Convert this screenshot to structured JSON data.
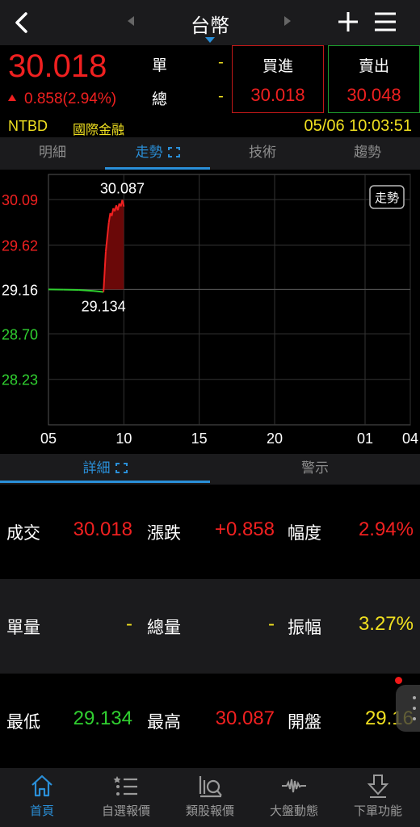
{
  "header": {
    "title": "台幣",
    "back_icon": "back-chevron-icon",
    "prev_icon": "prev-triangle-icon",
    "next_icon": "next-triangle-icon",
    "add_icon": "plus-icon",
    "menu_icon": "hamburger-menu-icon"
  },
  "quote": {
    "price": "30.018",
    "change": "0.858(2.94%)",
    "unit_label": "單",
    "total_label": "總",
    "unit_value": "-",
    "total_value": "-",
    "bid_label": "買進",
    "bid_value": "30.018",
    "ask_label": "賣出",
    "ask_value": "30.048",
    "code": "NTBD",
    "company": "國際金融",
    "datetime": "05/06 10:03:51",
    "colors": {
      "up": "#f02020",
      "down": "#30d030",
      "accent": "#2a8fd8",
      "highlight": "#f0e020"
    }
  },
  "tabs": [
    {
      "label": "明細"
    },
    {
      "label": "走勢"
    },
    {
      "label": "技術"
    },
    {
      "label": "趨勢"
    }
  ],
  "chart_data": {
    "type": "line",
    "badge": "走勢",
    "y_ticks": [
      "30.09",
      "29.62",
      "29.16",
      "28.70",
      "28.23"
    ],
    "y_tick_values": [
      30.09,
      29.62,
      29.16,
      28.7,
      28.23
    ],
    "x_ticks": [
      "05",
      "10",
      "15",
      "20",
      "01",
      "04"
    ],
    "ylim": [
      27.76,
      30.35
    ],
    "reference_price": 29.16,
    "high_label": "30.087",
    "low_label": "29.134",
    "series": [
      {
        "x": [
          5.0,
          6.0,
          7.0,
          8.0,
          8.65,
          8.8,
          9.0,
          9.1,
          9.2,
          9.3,
          9.4,
          9.5,
          9.6,
          9.7,
          9.8,
          9.9,
          10.0
        ],
        "values": [
          29.16,
          29.158,
          29.155,
          29.145,
          29.134,
          29.55,
          29.85,
          29.95,
          29.92,
          30.0,
          29.97,
          30.03,
          29.98,
          30.05,
          30.02,
          30.087,
          30.018
        ]
      }
    ],
    "grid": true
  },
  "detail_tabs": [
    {
      "label": "詳細"
    },
    {
      "label": "警示"
    }
  ],
  "details": [
    [
      {
        "label": "成交",
        "value": "30.018",
        "color": "red"
      },
      {
        "label": "漲跌",
        "value": "+0.858",
        "color": "red"
      },
      {
        "label": "幅度",
        "value": "2.94%",
        "color": "red"
      }
    ],
    [
      {
        "label": "單量",
        "value": "-",
        "color": "yellow"
      },
      {
        "label": "總量",
        "value": "-",
        "color": "yellow"
      },
      {
        "label": "振幅",
        "value": "3.27%",
        "color": "yellow"
      }
    ],
    [
      {
        "label": "最低",
        "value": "29.134",
        "color": "green"
      },
      {
        "label": "最高",
        "value": "30.087",
        "color": "red"
      },
      {
        "label": "開盤",
        "value": "29.16",
        "color": "yellow"
      }
    ]
  ],
  "bottom_nav": [
    {
      "label": "首頁",
      "icon": "home-icon"
    },
    {
      "label": "自選報價",
      "icon": "watchlist-icon"
    },
    {
      "label": "類股報價",
      "icon": "sector-search-icon"
    },
    {
      "label": "大盤動態",
      "icon": "market-pulse-icon"
    },
    {
      "label": "下單功能",
      "icon": "order-arrow-icon"
    }
  ]
}
